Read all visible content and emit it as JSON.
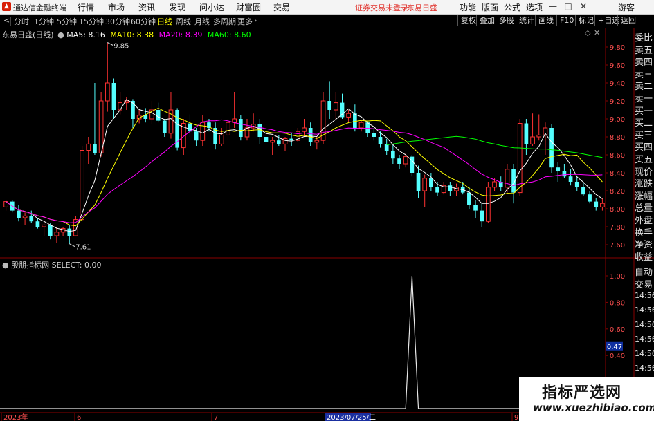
{
  "window": {
    "app_name": "通达信金融终端",
    "menu": [
      "行情",
      "市场",
      "资讯",
      "发现",
      "问小达",
      "财富圈",
      "交易"
    ],
    "warning": "证券交易未登录",
    "stock_title": "东易日盛",
    "right_menu": [
      "功能",
      "版面",
      "公式",
      "选项"
    ],
    "guest": "游客",
    "controls": [
      "—",
      "□",
      "✕"
    ]
  },
  "toolbar": {
    "back_arrow": "<",
    "periods": [
      "分时",
      "1分钟",
      "5分钟",
      "15分钟",
      "30分钟",
      "60分钟",
      "日线",
      "周线",
      "月线",
      "多周期",
      "更多"
    ],
    "active_period": "日线",
    "more_arrow": "›",
    "right_buttons": [
      "复权",
      "叠加",
      "多股",
      "统计",
      "画线",
      "F10",
      "标记",
      "+自选",
      "返回"
    ]
  },
  "main_chart": {
    "stock_label": "东易日盛(日线)",
    "ma": [
      {
        "name": "MA5",
        "value": "8.16",
        "color": "#ffffff"
      },
      {
        "name": "MA10",
        "value": "8.38",
        "color": "#ffff00"
      },
      {
        "name": "MA20",
        "value": "8.39",
        "color": "#ff00ff"
      },
      {
        "name": "MA60",
        "value": "8.60",
        "color": "#00ff00"
      }
    ],
    "max_label": "9.85",
    "min_label": "7.61",
    "y_ticks": [
      "9.80",
      "9.60",
      "9.40",
      "9.20",
      "9.00",
      "8.80",
      "8.60",
      "8.40",
      "8.20",
      "8.00",
      "7.80",
      "7.60"
    ]
  },
  "indicator": {
    "name": "殷朋指标网",
    "select_label": "SELECT:",
    "select_value": "0.00",
    "y_ticks": [
      "1.00",
      "0.80",
      "0.60",
      "0.40",
      "0.20"
    ],
    "current_value": "0.47"
  },
  "x_axis": {
    "labels": [
      "2023年",
      "6",
      "7",
      "2023/07/25/二",
      "9"
    ]
  },
  "right_panel": {
    "items": [
      "委比",
      "卖五",
      "卖四",
      "卖三",
      "卖二",
      "卖一",
      "买一",
      "买二",
      "买三",
      "买四",
      "买五",
      "现价",
      "涨跌",
      "涨幅",
      "总量",
      "外盘",
      "换手",
      "净资",
      "收益",
      "自动",
      "交易"
    ],
    "times": [
      "14:56",
      "14:56",
      "14:56",
      "14:56",
      "14:56",
      "14:56",
      "14:56",
      "14:56"
    ]
  },
  "watermark": {
    "line1": "指标严选网",
    "line2": "www.xuezhibiao.com"
  },
  "chart_data": {
    "type": "candlestick",
    "up_color": "#ff3232",
    "down_color": "#54ffff",
    "ylim": [
      7.5,
      9.9
    ],
    "candles": [
      [
        8.02,
        8.1,
        7.98,
        8.08
      ],
      [
        8.08,
        8.1,
        7.96,
        7.98
      ],
      [
        7.98,
        8.04,
        7.86,
        7.9
      ],
      [
        7.9,
        7.96,
        7.82,
        7.92
      ],
      [
        7.92,
        7.98,
        7.84,
        7.86
      ],
      [
        7.86,
        7.9,
        7.78,
        7.8
      ],
      [
        7.8,
        7.86,
        7.7,
        7.82
      ],
      [
        7.82,
        7.84,
        7.66,
        7.7
      ],
      [
        7.7,
        7.8,
        7.62,
        7.74
      ],
      [
        7.74,
        7.8,
        7.7,
        7.78
      ],
      [
        7.78,
        7.82,
        7.61,
        7.7
      ],
      [
        7.7,
        7.92,
        7.7,
        7.88
      ],
      [
        7.88,
        8.7,
        7.86,
        8.65
      ],
      [
        8.65,
        8.8,
        8.5,
        8.72
      ],
      [
        8.72,
        9.4,
        8.6,
        8.62
      ],
      [
        8.62,
        9.3,
        8.58,
        9.2
      ],
      [
        9.2,
        9.85,
        9.08,
        9.4
      ],
      [
        9.4,
        9.45,
        9.0,
        9.1
      ],
      [
        9.1,
        9.3,
        9.05,
        9.18
      ],
      [
        9.18,
        9.24,
        9.1,
        9.2
      ],
      [
        9.2,
        9.22,
        8.9,
        9.0
      ],
      [
        9.0,
        9.1,
        8.95,
        9.04
      ],
      [
        9.04,
        9.12,
        8.96,
        9.0
      ],
      [
        9.0,
        9.2,
        8.94,
        9.1
      ],
      [
        9.1,
        9.18,
        8.96,
        8.98
      ],
      [
        8.98,
        9.0,
        8.8,
        8.84
      ],
      [
        8.84,
        9.3,
        8.78,
        9.1
      ],
      [
        9.1,
        9.12,
        8.65,
        8.68
      ],
      [
        8.68,
        9.0,
        8.6,
        8.95
      ],
      [
        8.95,
        9.05,
        8.8,
        8.86
      ],
      [
        8.86,
        8.9,
        8.7,
        8.76
      ],
      [
        8.76,
        9.04,
        8.7,
        8.96
      ],
      [
        8.96,
        9.0,
        8.86,
        8.9
      ],
      [
        8.9,
        8.96,
        8.66,
        8.72
      ],
      [
        8.72,
        8.9,
        8.7,
        8.82
      ],
      [
        8.82,
        9.0,
        8.76,
        8.96
      ],
      [
        8.96,
        9.3,
        8.9,
        9.0
      ],
      [
        9.0,
        9.04,
        8.76,
        8.8
      ],
      [
        8.8,
        9.0,
        8.76,
        8.9
      ],
      [
        8.9,
        9.06,
        8.86,
        8.94
      ],
      [
        8.94,
        9.0,
        8.72,
        8.8
      ],
      [
        8.8,
        8.84,
        8.66,
        8.74
      ],
      [
        8.74,
        8.8,
        8.6,
        8.76
      ],
      [
        8.76,
        8.82,
        8.7,
        8.72
      ],
      [
        8.72,
        8.8,
        8.64,
        8.78
      ],
      [
        8.78,
        8.84,
        8.7,
        8.76
      ],
      [
        8.76,
        8.9,
        8.74,
        8.86
      ],
      [
        8.86,
        9.0,
        8.8,
        8.9
      ],
      [
        8.9,
        8.96,
        8.7,
        8.74
      ],
      [
        8.74,
        8.8,
        8.66,
        8.76
      ],
      [
        8.76,
        9.3,
        8.72,
        9.2
      ],
      [
        9.2,
        9.42,
        9.0,
        9.1
      ],
      [
        9.1,
        9.3,
        9.0,
        9.18
      ],
      [
        9.18,
        9.28,
        9.0,
        9.02
      ],
      [
        9.02,
        9.1,
        8.96,
        9.06
      ],
      [
        9.06,
        9.16,
        8.86,
        8.9
      ],
      [
        8.9,
        8.98,
        8.86,
        8.96
      ],
      [
        8.96,
        8.98,
        8.8,
        8.84
      ],
      [
        8.84,
        8.9,
        8.76,
        8.8
      ],
      [
        8.8,
        8.86,
        8.68,
        8.72
      ],
      [
        8.72,
        8.78,
        8.6,
        8.64
      ],
      [
        8.64,
        8.72,
        8.5,
        8.56
      ],
      [
        8.56,
        8.6,
        8.44,
        8.5
      ],
      [
        8.5,
        8.62,
        8.46,
        8.58
      ],
      [
        8.58,
        8.6,
        8.36,
        8.4
      ],
      [
        8.4,
        8.48,
        8.12,
        8.2
      ],
      [
        8.2,
        8.38,
        8.02,
        8.34
      ],
      [
        8.34,
        8.4,
        8.2,
        8.24
      ],
      [
        8.24,
        8.3,
        8.14,
        8.18
      ],
      [
        8.18,
        8.3,
        8.16,
        8.26
      ],
      [
        8.26,
        8.3,
        8.14,
        8.2
      ],
      [
        8.2,
        8.28,
        8.14,
        8.24
      ],
      [
        8.24,
        8.3,
        8.16,
        8.18
      ],
      [
        8.18,
        8.24,
        8.0,
        8.04
      ],
      [
        8.04,
        8.1,
        7.9,
        7.98
      ],
      [
        7.98,
        8.06,
        7.8,
        7.86
      ],
      [
        7.86,
        8.3,
        7.84,
        8.24
      ],
      [
        8.24,
        8.34,
        8.2,
        8.3
      ],
      [
        8.3,
        8.36,
        8.2,
        8.24
      ],
      [
        8.24,
        8.5,
        8.18,
        8.44
      ],
      [
        8.44,
        8.5,
        8.06,
        8.18
      ],
      [
        8.18,
        9.0,
        8.14,
        8.95
      ],
      [
        8.95,
        9.0,
        8.6,
        8.72
      ],
      [
        8.72,
        9.06,
        8.7,
        8.8
      ],
      [
        8.8,
        9.05,
        8.76,
        8.82
      ],
      [
        8.82,
        8.96,
        8.6,
        8.9
      ],
      [
        8.9,
        8.94,
        8.4,
        8.46
      ],
      [
        8.46,
        8.52,
        8.3,
        8.42
      ],
      [
        8.42,
        8.5,
        8.34,
        8.36
      ],
      [
        8.36,
        8.44,
        8.26,
        8.3
      ],
      [
        8.3,
        8.36,
        8.2,
        8.24
      ],
      [
        8.24,
        8.3,
        8.14,
        8.16
      ],
      [
        8.16,
        8.2,
        8.06,
        8.08
      ],
      [
        8.08,
        8.12,
        7.98,
        8.02
      ],
      [
        8.02,
        8.12,
        7.98,
        8.06
      ]
    ],
    "select_signal_index": 64
  }
}
